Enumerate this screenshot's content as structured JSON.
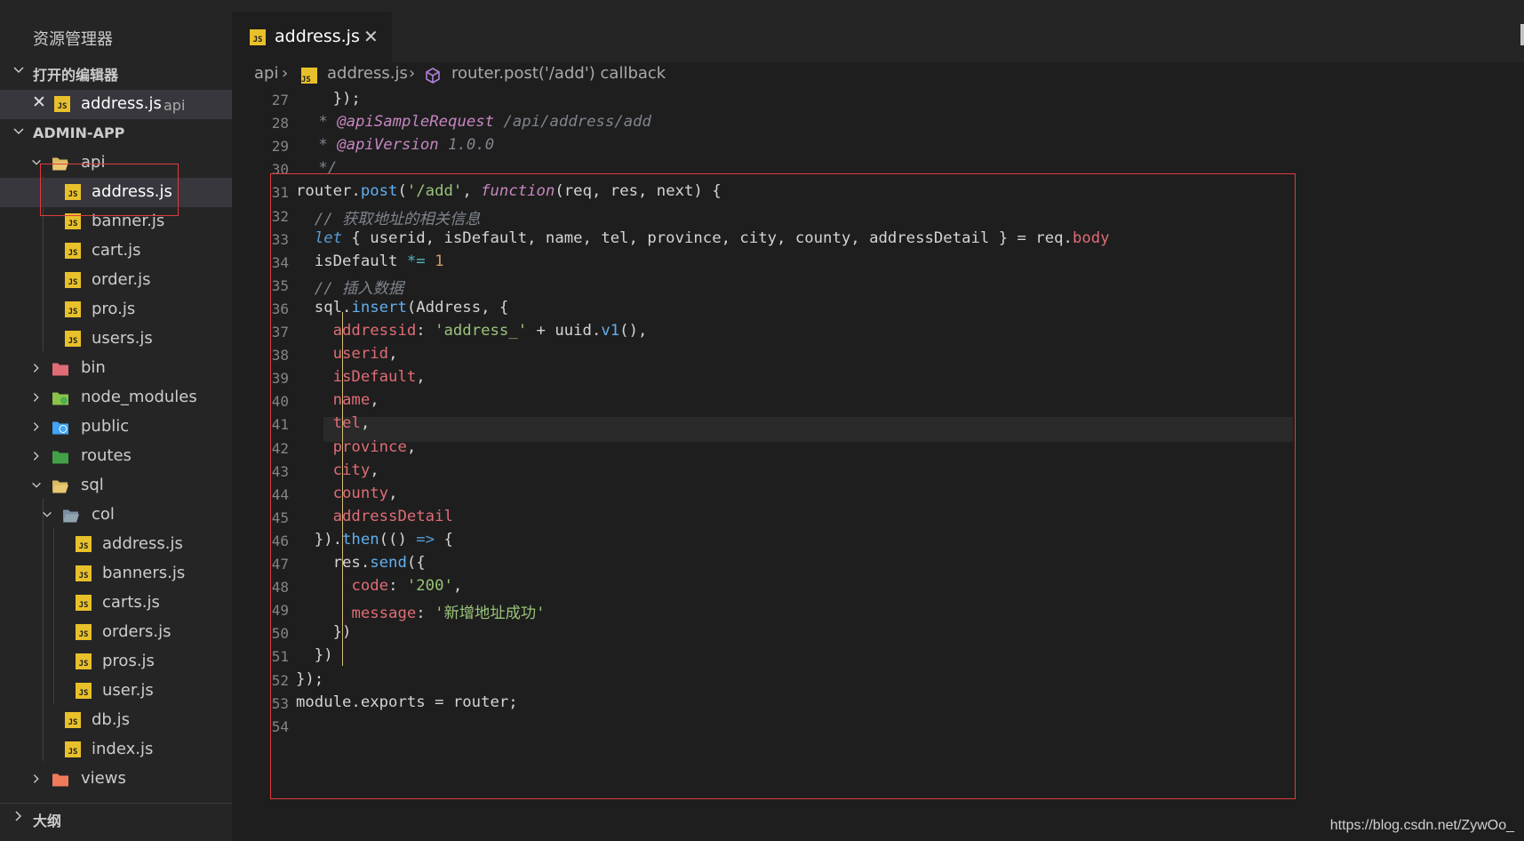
{
  "explorer": {
    "title": "资源管理器",
    "open_editors_label": "打开的编辑器",
    "open_editor": {
      "name": "address.js",
      "folder": "api"
    },
    "project_label": "ADMIN-APP",
    "outline_label": "大纲",
    "tree": [
      {
        "label": "api"
      },
      {
        "label": "address.js"
      },
      {
        "label": "banner.js"
      },
      {
        "label": "cart.js"
      },
      {
        "label": "order.js"
      },
      {
        "label": "pro.js"
      },
      {
        "label": "users.js"
      },
      {
        "label": "bin"
      },
      {
        "label": "node_modules"
      },
      {
        "label": "public"
      },
      {
        "label": "routes"
      },
      {
        "label": "sql"
      },
      {
        "label": "col"
      },
      {
        "label": "address.js"
      },
      {
        "label": "banners.js"
      },
      {
        "label": "carts.js"
      },
      {
        "label": "orders.js"
      },
      {
        "label": "pros.js"
      },
      {
        "label": "user.js"
      },
      {
        "label": "db.js"
      },
      {
        "label": "index.js"
      },
      {
        "label": "views"
      }
    ]
  },
  "tab": {
    "label": "address.js",
    "close": "✕",
    "icon_text": "JS"
  },
  "breadcrumb": {
    "folder": "api",
    "file": "address.js",
    "symbol": "router.post('/add') callback",
    "sep": "›"
  },
  "editor": {
    "line_numbers": [
      "27",
      "28",
      "29",
      "30",
      "31",
      "32",
      "33",
      "34",
      "35",
      "36",
      "37",
      "38",
      "39",
      "40",
      "41",
      "42",
      "43",
      "44",
      "45",
      "46",
      "47",
      "48",
      "49",
      "50",
      "51",
      "52",
      "53",
      "54"
    ],
    "lines": [
      "    });",
      " * @apiSampleRequest /api/address/add",
      " * @apiVersion 1.0.0",
      " */",
      "router.post('/add', function(req, res, next) {",
      "  // 获取地址的相关信息",
      "  let { userid, isDefault, name, tel, province, city, county, addressDetail } = req.body",
      "  isDefault *= 1",
      "  // 插入数据",
      "  sql.insert(Address, {",
      "    addressid: 'address_' + uuid.v1(),",
      "    userid,",
      "    isDefault,",
      "    name,",
      "    tel,",
      "    province,",
      "    city,",
      "    county,",
      "    addressDetail",
      "  }).then(() => {",
      "    res.send({",
      "      code: '200',",
      "      message: '新增地址成功'",
      "    })",
      "  })",
      "});",
      "module.exports = router;",
      ""
    ]
  },
  "watermark": "https://blog.csdn.net/ZywOo_",
  "colors": {
    "js_icon": "#e8c02a",
    "highlight_box": "#e03c3c",
    "selection": "#37373d"
  }
}
